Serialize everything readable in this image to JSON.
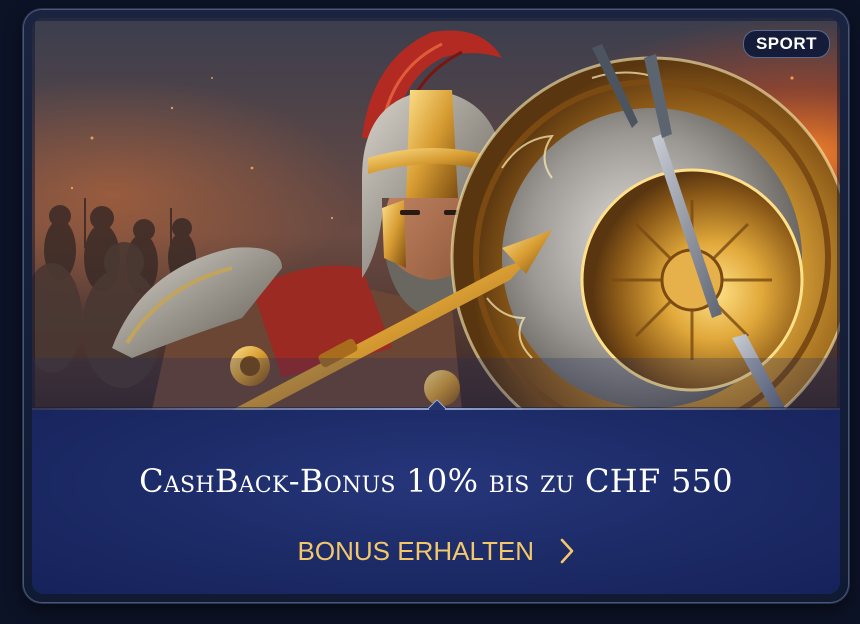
{
  "badge": {
    "label": "SPORT"
  },
  "promo": {
    "title": "CashBack-Bonus 10% bis zu CHF 550",
    "cta_label": "BONUS ERHALTEN",
    "cta_icon": "chevron-right-icon"
  },
  "colors": {
    "accent": "#f2c86a",
    "panel": "#1c2a66",
    "badge_bg": "#141c3a"
  }
}
